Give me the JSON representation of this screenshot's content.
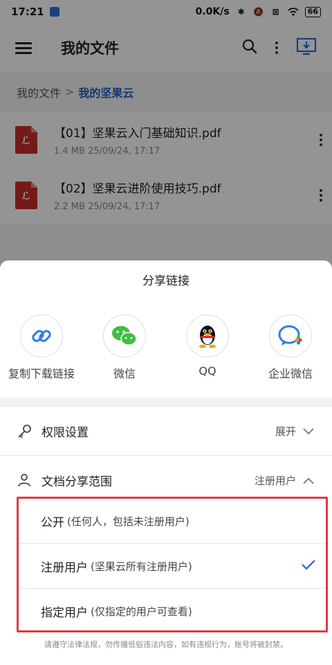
{
  "statusbar": {
    "time": "17:21",
    "net_speed": "0.0K/s",
    "battery": "66"
  },
  "toolbar": {
    "title": "我的文件"
  },
  "breadcrumb": {
    "root": "我的文件",
    "separator": ">",
    "current": "我的坚果云"
  },
  "files": [
    {
      "name": "【01】坚果云入门基础知识.pdf",
      "meta": "1.4 MB 25/09/24, 17:17"
    },
    {
      "name": "【02】坚果云进阶使用技巧.pdf",
      "meta": "2.2 MB 25/09/24, 17:17"
    }
  ],
  "sheet": {
    "title": "分享链接",
    "share_targets": [
      {
        "label": "复制下载链接",
        "icon": "link-icon"
      },
      {
        "label": "微信",
        "icon": "wechat-icon"
      },
      {
        "label": "QQ",
        "icon": "qq-icon"
      },
      {
        "label": "企业微信",
        "icon": "wecom-icon"
      }
    ],
    "permission": {
      "label": "权限设置",
      "value": "展开"
    },
    "scope": {
      "label": "文档分享范围",
      "value": "注册用户"
    },
    "options": [
      {
        "main": "公开",
        "sub": "(任何人，包括未注册用户)",
        "selected": false
      },
      {
        "main": "注册用户",
        "sub": "(坚果云所有注册用户)",
        "selected": true
      },
      {
        "main": "指定用户",
        "sub": "(仅指定的用户可查看)",
        "selected": false
      }
    ],
    "footer": "请遵守法律法规，勿传播低俗违法内容，如有违规行为，账号将被封禁。"
  },
  "colors": {
    "accent": "#1e5fbf",
    "check": "#2f6fe0",
    "highlight_border": "#e0393e",
    "pdf": "#c9302c"
  }
}
